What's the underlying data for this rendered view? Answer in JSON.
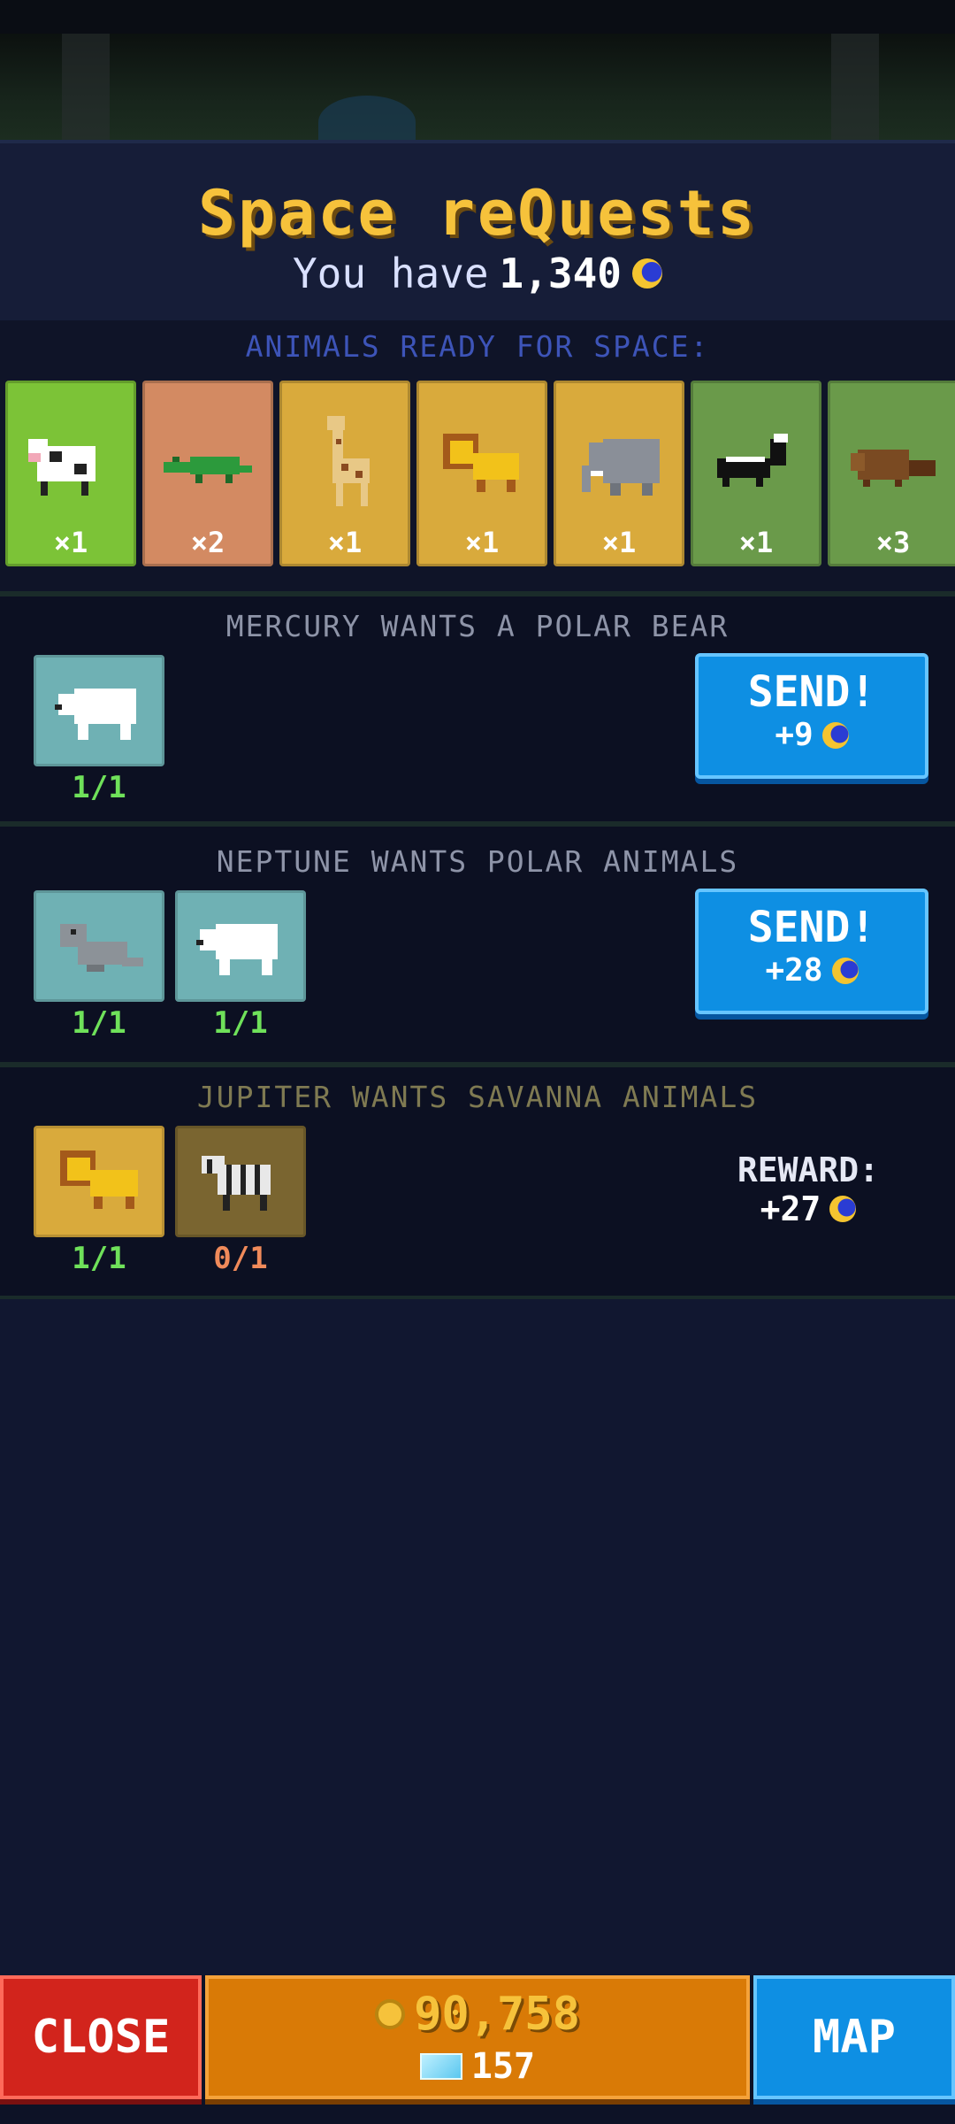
{
  "header": {
    "title": "Space reQuests",
    "balance_prefix": "You have",
    "balance": "1,340",
    "currency_icon": "moon-token-icon"
  },
  "ready": {
    "label": "ANIMALS READY FOR SPACE:",
    "animals": [
      {
        "name": "cow",
        "count": "×1",
        "color": "#7cc337"
      },
      {
        "name": "crocodile",
        "count": "×2",
        "color": "#d38a62"
      },
      {
        "name": "giraffe",
        "count": "×1",
        "color": "#d9aa3c"
      },
      {
        "name": "lion",
        "count": "×1",
        "color": "#d9aa3c"
      },
      {
        "name": "elephant",
        "count": "×1",
        "color": "#d9aa3c"
      },
      {
        "name": "skunk",
        "count": "×1",
        "color": "#6a9a4a"
      },
      {
        "name": "beaver",
        "count": "×3",
        "color": "#6a9a4a"
      }
    ]
  },
  "requests": [
    {
      "title": "MERCURY WANTS A POLAR BEAR",
      "animals": [
        {
          "name": "polar-bear",
          "progress": "1/1",
          "color": "#6fb1b4",
          "met": true
        }
      ],
      "action": {
        "label": "SEND!",
        "reward": "+9"
      }
    },
    {
      "title": "NEPTUNE WANTS POLAR ANIMALS",
      "animals": [
        {
          "name": "seal",
          "progress": "1/1",
          "color": "#6fb1b4",
          "met": true
        },
        {
          "name": "polar-bear",
          "progress": "1/1",
          "color": "#6fb1b4",
          "met": true
        }
      ],
      "action": {
        "label": "SEND!",
        "reward": "+28"
      }
    },
    {
      "title": "JUPITER WANTS SAVANNA ANIMALS",
      "animals": [
        {
          "name": "lion",
          "progress": "1/1",
          "color": "#d9aa3c",
          "met": true
        },
        {
          "name": "zebra",
          "progress": "0/1",
          "color": "#7a6530",
          "met": false
        }
      ],
      "reward": {
        "label": "REWARD:",
        "value": "+27"
      }
    }
  ],
  "footer": {
    "close_label": "CLOSE",
    "coins": "90,758",
    "gems": "157",
    "map_label": "MAP"
  }
}
